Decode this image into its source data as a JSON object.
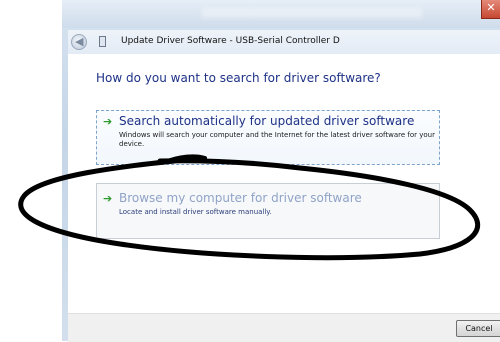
{
  "window": {
    "title": "Update Driver Software - USB-Serial Controller D",
    "close_glyph": "✕"
  },
  "header": {
    "back_icon": "back-arrow-icon",
    "device_icon": "usb-device-icon"
  },
  "main": {
    "question": "How do you want to search for driver software?",
    "options": [
      {
        "title": "Search automatically for updated driver software",
        "description": "Windows will search your computer and the Internet for the latest driver software for your device.",
        "icon": "green-arrow-icon"
      },
      {
        "title": "Browse my computer for driver software",
        "description": "Locate and install driver software manually.",
        "icon": "green-arrow-icon"
      }
    ]
  },
  "footer": {
    "cancel_label": "Cancel"
  },
  "colors": {
    "question_text": "#1e3287",
    "option1_title": "#1e3287",
    "option2_title": "#8fa3c8",
    "arrow_green": "#2e9b2e",
    "scribble": "#000000"
  }
}
